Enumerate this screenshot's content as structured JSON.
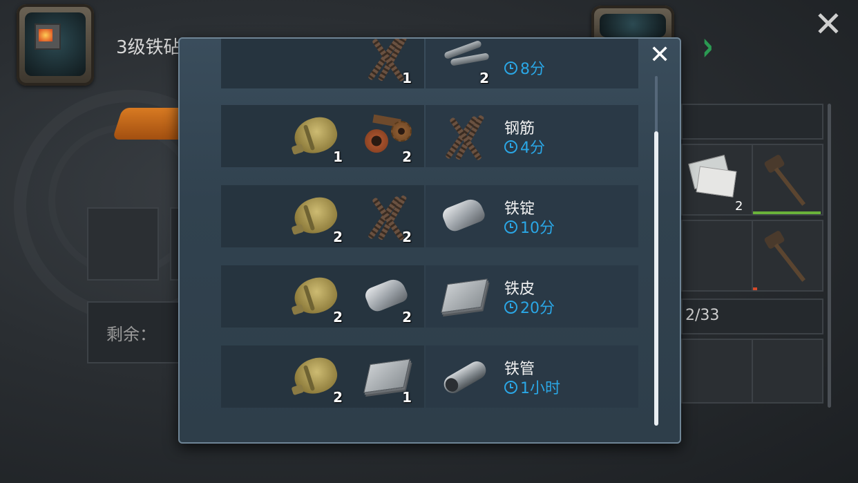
{
  "background": {
    "station_title": "3级铁砧",
    "remaining_label": "剩余：",
    "inventory_capacity": "2/33",
    "inventory_items": [
      {
        "icon": "papers-icon",
        "count": "2"
      },
      {
        "icon": "hammer-icon",
        "durability_fraction": 1.0
      },
      {
        "icon": "hammer-icon",
        "durability_fraction": 0.05
      }
    ]
  },
  "modal": {
    "close_icon": "close-icon",
    "recipes": [
      {
        "inputs": [
          {
            "icon": "rebar-icon",
            "count": "1"
          }
        ],
        "output_icon": "pipes-icon",
        "output_count": "2",
        "name": "",
        "time": "8分"
      },
      {
        "inputs": [
          {
            "icon": "canteen-icon",
            "count": "1"
          },
          {
            "icon": "scrap-metal-icon",
            "count": "2"
          }
        ],
        "output_icon": "rebar-icon",
        "name": "钢筋",
        "time": "4分"
      },
      {
        "inputs": [
          {
            "icon": "canteen-icon",
            "count": "2"
          },
          {
            "icon": "rebar-icon",
            "count": "2"
          }
        ],
        "output_icon": "iron-ingot-icon",
        "name": "铁锭",
        "time": "10分"
      },
      {
        "inputs": [
          {
            "icon": "canteen-icon",
            "count": "2"
          },
          {
            "icon": "iron-ingot-icon",
            "count": "2"
          }
        ],
        "output_icon": "iron-sheet-icon",
        "name": "铁皮",
        "time": "20分"
      },
      {
        "inputs": [
          {
            "icon": "canteen-icon",
            "count": "2"
          },
          {
            "icon": "iron-sheet-icon",
            "count": "1"
          }
        ],
        "output_icon": "iron-pipe-icon",
        "name": "铁管",
        "time": "1小时"
      }
    ]
  },
  "colors": {
    "time_blue": "#2aa7e6",
    "panel": "#31424f",
    "arrow_green": "#2b9a52"
  }
}
